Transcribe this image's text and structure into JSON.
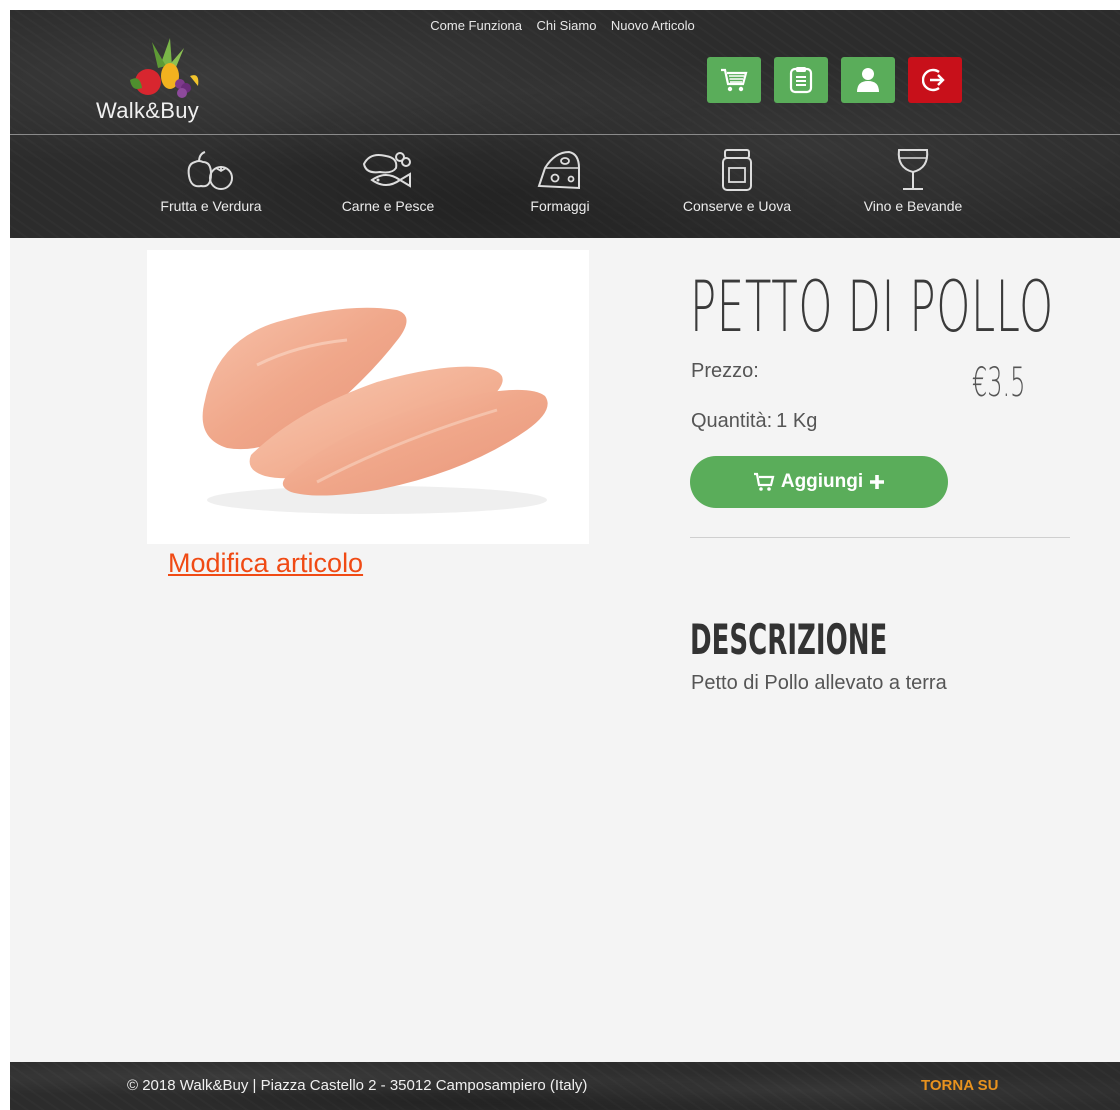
{
  "top_nav": {
    "items": [
      "Come Funziona",
      "Chi Siamo",
      "Nuovo Articolo"
    ]
  },
  "brand": {
    "name": "Walk&Buy"
  },
  "header_icons": [
    "cart-icon",
    "clipboard-icon",
    "user-icon",
    "logout-icon"
  ],
  "categories": [
    {
      "label": "Frutta e Verdura",
      "icon": "fruit-veg-icon"
    },
    {
      "label": "Carne e Pesce",
      "icon": "meat-fish-icon"
    },
    {
      "label": "Formaggi",
      "icon": "cheese-icon"
    },
    {
      "label": "Conserve e Uova",
      "icon": "jar-icon"
    },
    {
      "label": "Vino e Bevande",
      "icon": "wine-glass-icon"
    }
  ],
  "product": {
    "title": "PETTO DI POLLO",
    "price_label": "Prezzo:",
    "price_value": "€3.5",
    "quantity_label": "Quantità:",
    "quantity_value": "1 Kg",
    "add_label": "Aggiungi",
    "edit_link": "Modifica articolo",
    "description_title": "DESCRIZIONE",
    "description": "Petto di Pollo allevato a terra"
  },
  "footer": {
    "copyright": "© 2018 Walk&Buy | Piazza Castello 2 - 35012 Camposampiero (Italy)",
    "back_to_top": "TORNA SU"
  },
  "colors": {
    "accent_green": "#5aad5a",
    "logout_red": "#c8101a",
    "link_orange": "#f04a14",
    "footer_orange": "#e8921e"
  }
}
